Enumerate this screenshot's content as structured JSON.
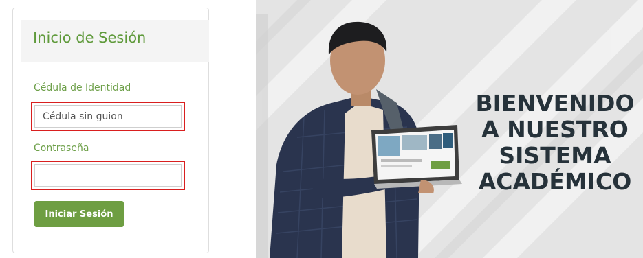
{
  "login": {
    "title": "Inicio de Sesión",
    "id_label": "Cédula de Identidad",
    "id_placeholder": "Cédula sin guion",
    "id_value": "",
    "password_label": "Contraseña",
    "password_value": "",
    "submit_label": "Iniciar Sesión"
  },
  "banner": {
    "lines": [
      "BIENVENIDO",
      "A NUESTRO",
      "SISTEMA",
      "ACADÉMICO"
    ]
  },
  "colors": {
    "accent_green": "#6e9e42",
    "highlight_red": "#d91f1f",
    "banner_text": "#26323a"
  }
}
